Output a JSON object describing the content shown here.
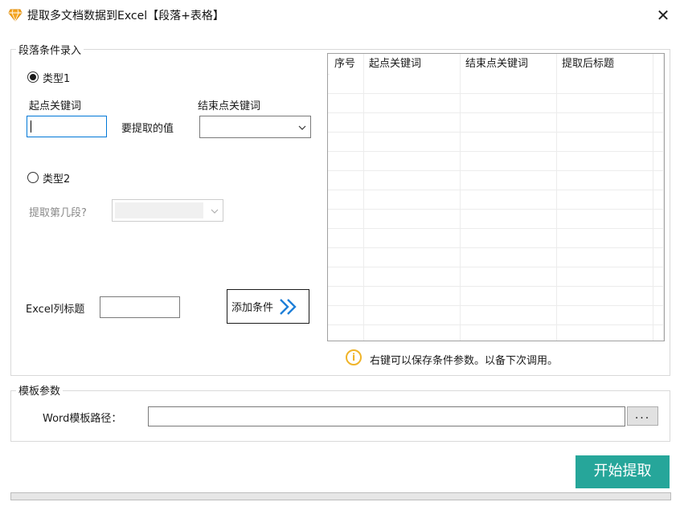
{
  "window": {
    "title": "提取多文档数据到Excel【段落+表格】",
    "close_glyph": "✕",
    "icon": "diamond-icon"
  },
  "paragraph_group": {
    "legend": "段落条件录入",
    "type1": {
      "label": "类型1",
      "checked": true,
      "start_keyword_label": "起点关键词",
      "start_keyword_value": "",
      "extract_value_label": "要提取的值",
      "end_keyword_label": "结束点关键词",
      "end_keyword_selected": ""
    },
    "type2": {
      "label": "类型2",
      "checked": false,
      "paragraph_index_label": "提取第几段?",
      "paragraph_index_selected": ""
    },
    "excel_column_label": "Excel列标题",
    "excel_column_value": "",
    "add_button_label": "添加条件",
    "grid": {
      "columns": [
        "序号",
        "起点关键词",
        "结束点关键词",
        "提取后标题"
      ],
      "rows": []
    },
    "hint": {
      "icon_glyph": "i",
      "text": "右键可以保存条件参数。以备下次调用。",
      "color": "#f0b429"
    }
  },
  "template_group": {
    "legend": "模板参数",
    "word_path_label": "Word模板路径：",
    "word_path_value": "",
    "browse_label": "..."
  },
  "start_button_label": "开始提取",
  "progress_percent": 0,
  "colors": {
    "accent": "#26a69a",
    "focus_border": "#0078d7",
    "add_icon": "#1e7fd8"
  }
}
